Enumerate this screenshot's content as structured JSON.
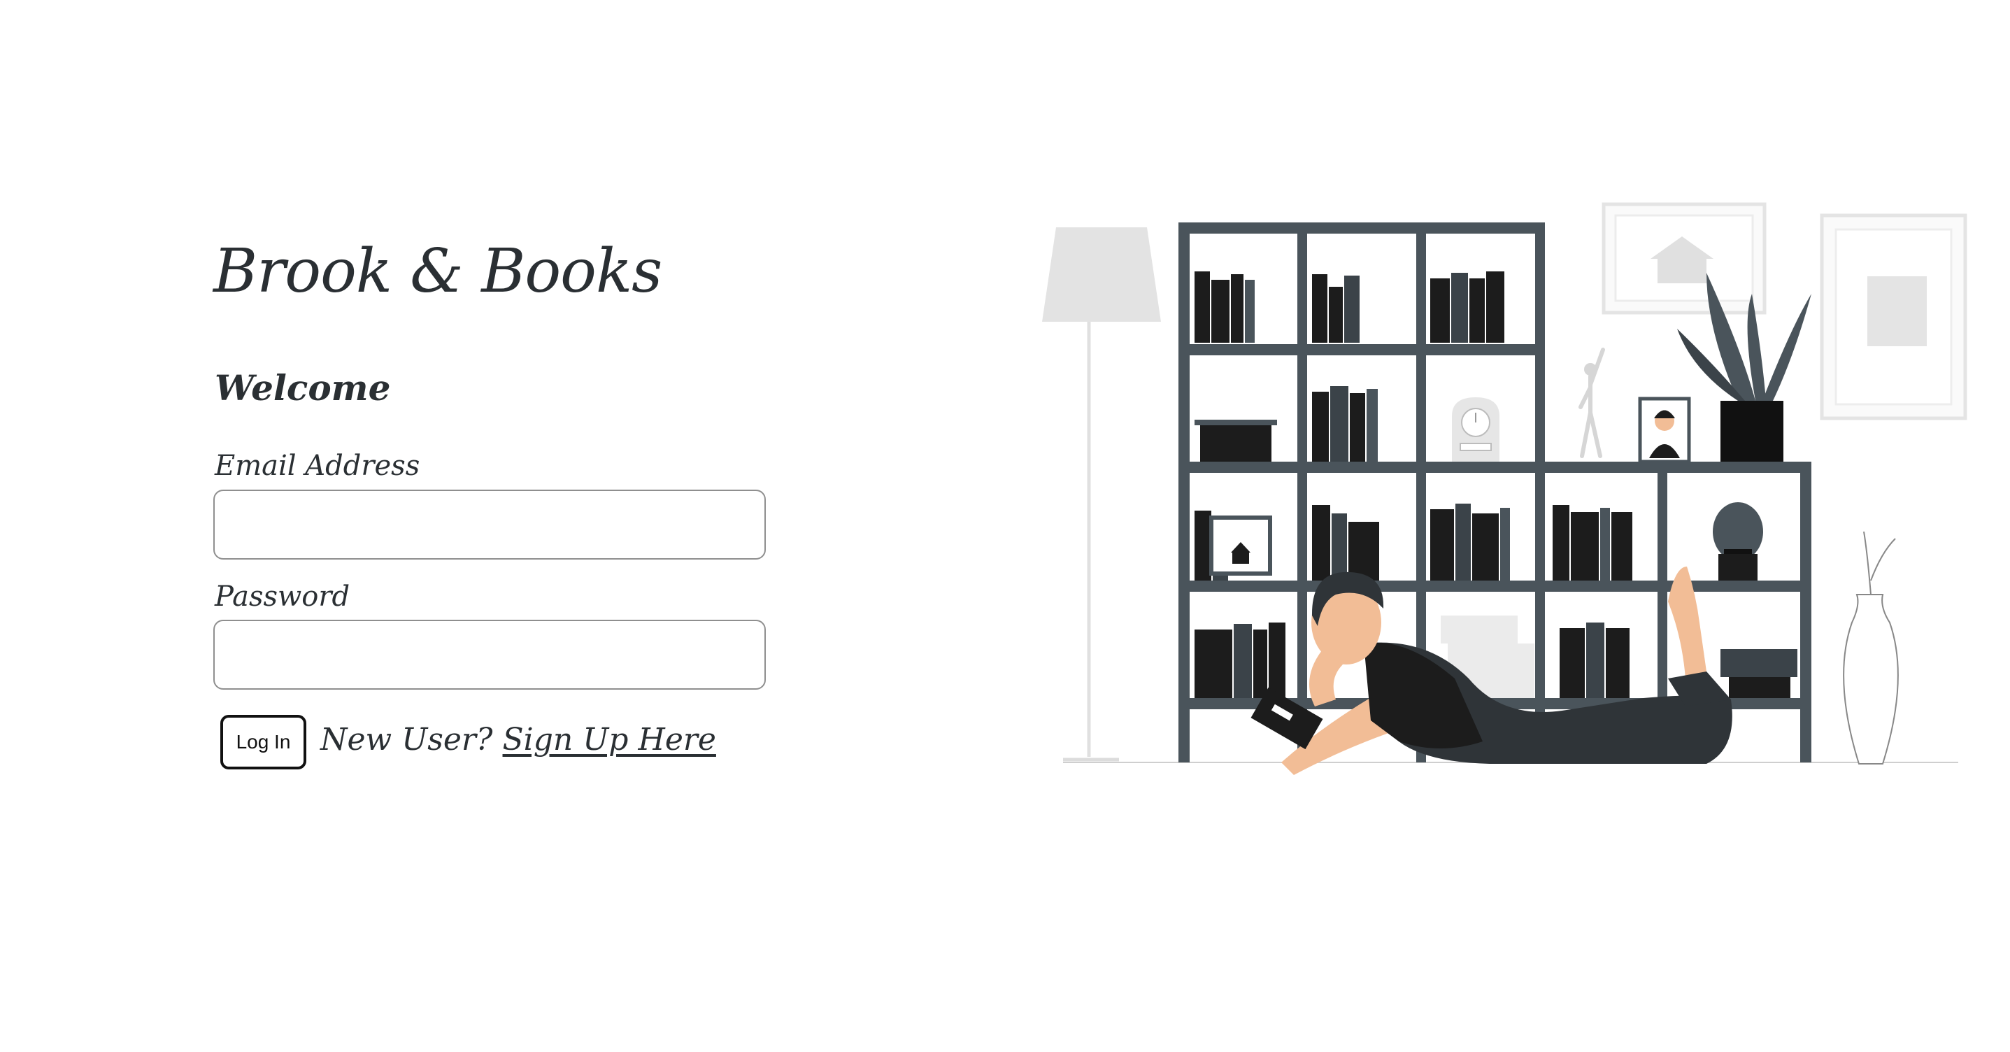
{
  "brand": {
    "title": "Brook & Books"
  },
  "login": {
    "welcome": "Welcome",
    "email_label": "Email Address",
    "email_value": "",
    "password_label": "Password",
    "password_value": "",
    "login_button": "Log In",
    "new_user_text": "New User?",
    "signup_link": "Sign Up Here"
  },
  "colors": {
    "text": "#2a2f33",
    "shelf": "#4a545b",
    "book_dark": "#1c1c1c",
    "skin": "#f2bd96",
    "light_gray": "#e3e3e3"
  }
}
